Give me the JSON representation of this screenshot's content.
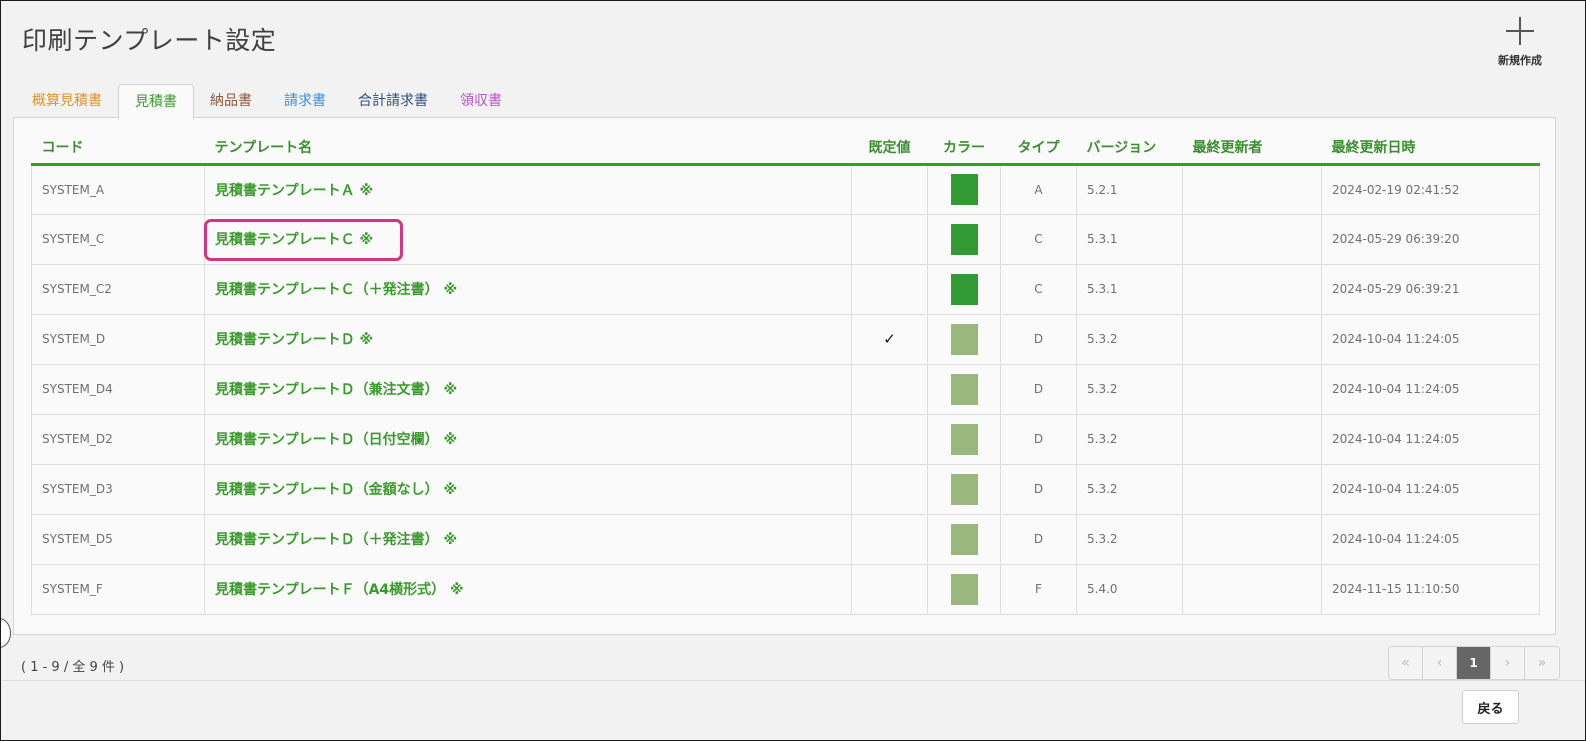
{
  "page": {
    "title": "印刷テンプレート設定"
  },
  "new_button": {
    "label": "新規作成"
  },
  "tabs": [
    {
      "label": "概算見積書",
      "color": "#e0922a",
      "active": false
    },
    {
      "label": "見積書",
      "color": "#3a9b2c",
      "active": true
    },
    {
      "label": "納品書",
      "color": "#8a5a3c",
      "active": false
    },
    {
      "label": "請求書",
      "color": "#3b8fd6",
      "active": false
    },
    {
      "label": "合計請求書",
      "color": "#2d4f7c",
      "active": false
    },
    {
      "label": "領収書",
      "color": "#b455c4",
      "active": false
    }
  ],
  "table": {
    "headers": {
      "code": "コード",
      "name": "テンプレート名",
      "default": "既定値",
      "color": "カラー",
      "type": "タイプ",
      "version": "バージョン",
      "updated_by": "最終更新者",
      "updated_at": "最終更新日時"
    },
    "rows": [
      {
        "code": "SYSTEM_A",
        "name": "見積書テンプレートＡ ※",
        "default": "",
        "color": "#339933",
        "type": "A",
        "version": "5.2.1",
        "updated_by": "",
        "updated_at": "2024-02-19 02:41:52"
      },
      {
        "code": "SYSTEM_C",
        "name": "見積書テンプレートＣ ※",
        "default": "",
        "color": "#339933",
        "type": "C",
        "version": "5.3.1",
        "updated_by": "",
        "updated_at": "2024-05-29 06:39:20"
      },
      {
        "code": "SYSTEM_C2",
        "name": "見積書テンプレートＣ（＋発注書） ※",
        "default": "",
        "color": "#339933",
        "type": "C",
        "version": "5.3.1",
        "updated_by": "",
        "updated_at": "2024-05-29 06:39:21"
      },
      {
        "code": "SYSTEM_D",
        "name": "見積書テンプレートＤ ※",
        "default": "✓",
        "color": "#9ab87e",
        "type": "D",
        "version": "5.3.2",
        "updated_by": "",
        "updated_at": "2024-10-04 11:24:05"
      },
      {
        "code": "SYSTEM_D4",
        "name": "見積書テンプレートＤ（兼注文書） ※",
        "default": "",
        "color": "#9ab87e",
        "type": "D",
        "version": "5.3.2",
        "updated_by": "",
        "updated_at": "2024-10-04 11:24:05"
      },
      {
        "code": "SYSTEM_D2",
        "name": "見積書テンプレートＤ（日付空欄） ※",
        "default": "",
        "color": "#9ab87e",
        "type": "D",
        "version": "5.3.2",
        "updated_by": "",
        "updated_at": "2024-10-04 11:24:05"
      },
      {
        "code": "SYSTEM_D3",
        "name": "見積書テンプレートＤ（金額なし） ※",
        "default": "",
        "color": "#9ab87e",
        "type": "D",
        "version": "5.3.2",
        "updated_by": "",
        "updated_at": "2024-10-04 11:24:05"
      },
      {
        "code": "SYSTEM_D5",
        "name": "見積書テンプレートＤ（＋発注書） ※",
        "default": "",
        "color": "#9ab87e",
        "type": "D",
        "version": "5.3.2",
        "updated_by": "",
        "updated_at": "2024-10-04 11:24:05"
      },
      {
        "code": "SYSTEM_F",
        "name": "見積書テンプレートＦ（A4横形式） ※",
        "default": "",
        "color": "#9ab87e",
        "type": "F",
        "version": "5.4.0",
        "updated_by": "",
        "updated_at": "2024-11-15 11:10:50"
      }
    ]
  },
  "footer": {
    "count": "( 1 - 9 / 全 9 件 )"
  },
  "pagination": {
    "first": "«",
    "prev": "‹",
    "current": "1",
    "next": "›",
    "last": "»"
  },
  "back_button": {
    "label": "戻る"
  }
}
